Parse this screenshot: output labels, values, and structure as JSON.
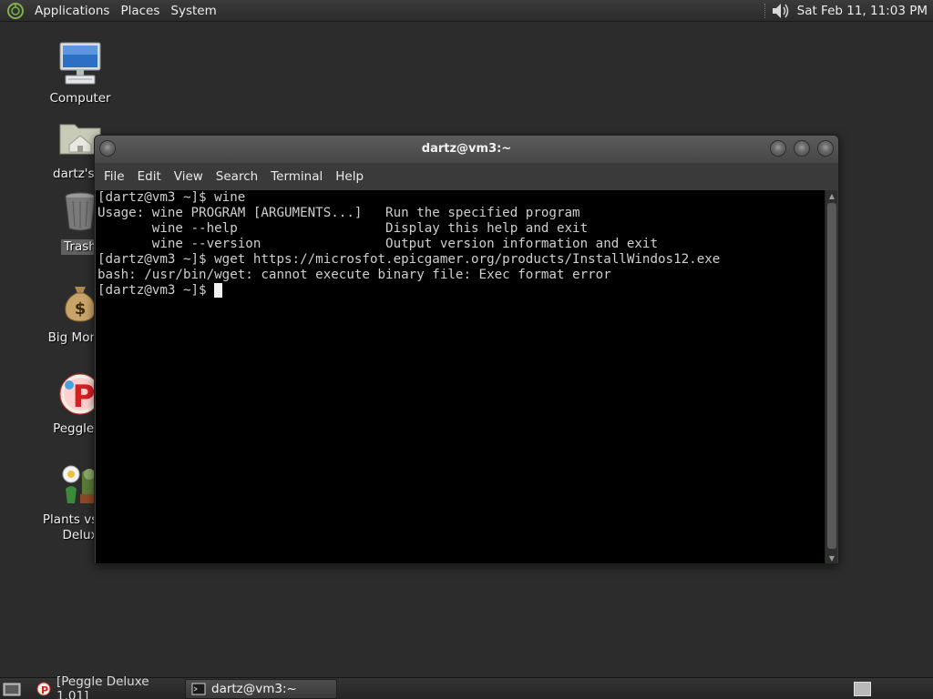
{
  "top_panel": {
    "menus": [
      "Applications",
      "Places",
      "System"
    ],
    "clock": "Sat Feb 11, 11:03 PM",
    "logo_icon": "distro-logo-icon",
    "volume_icon": "volume-icon"
  },
  "desktop": {
    "icons": [
      {
        "label": "Computer",
        "icon": "computer-icon"
      },
      {
        "label": "dartz's H",
        "icon": "home-folder-icon"
      },
      {
        "label": "Trash",
        "icon": "trash-icon",
        "selected": true
      },
      {
        "label": "Big Money",
        "icon": "money-bag-icon"
      },
      {
        "label": "Peggle D",
        "icon": "peggle-icon"
      },
      {
        "label_line1": "Plants vs Zo",
        "label_line2": "Delux",
        "icon": "plants-vs-zombies-icon"
      }
    ]
  },
  "terminal": {
    "title": "dartz@vm3:~",
    "menus": [
      "File",
      "Edit",
      "View",
      "Search",
      "Terminal",
      "Help"
    ],
    "lines": [
      "[dartz@vm3 ~]$ wine",
      "Usage: wine PROGRAM [ARGUMENTS...]   Run the specified program",
      "       wine --help                   Display this help and exit",
      "       wine --version                Output version information and exit",
      "[dartz@vm3 ~]$ wget https://microsfot.epicgamer.org/products/InstallWindos12.exe",
      "bash: /usr/bin/wget: cannot execute binary file: Exec format error"
    ],
    "prompt": "[dartz@vm3 ~]$ "
  },
  "taskbar": {
    "tasks": [
      {
        "label": "[Peggle Deluxe 1.01]",
        "icon": "peggle-small-icon",
        "active": false
      },
      {
        "label": "dartz@vm3:~",
        "icon": "terminal-small-icon",
        "active": true
      }
    ]
  },
  "colors": {
    "desktop_bg": "#2b2c2b",
    "terminal_bg": "#000000",
    "terminal_fg": "#cfcfcf"
  }
}
